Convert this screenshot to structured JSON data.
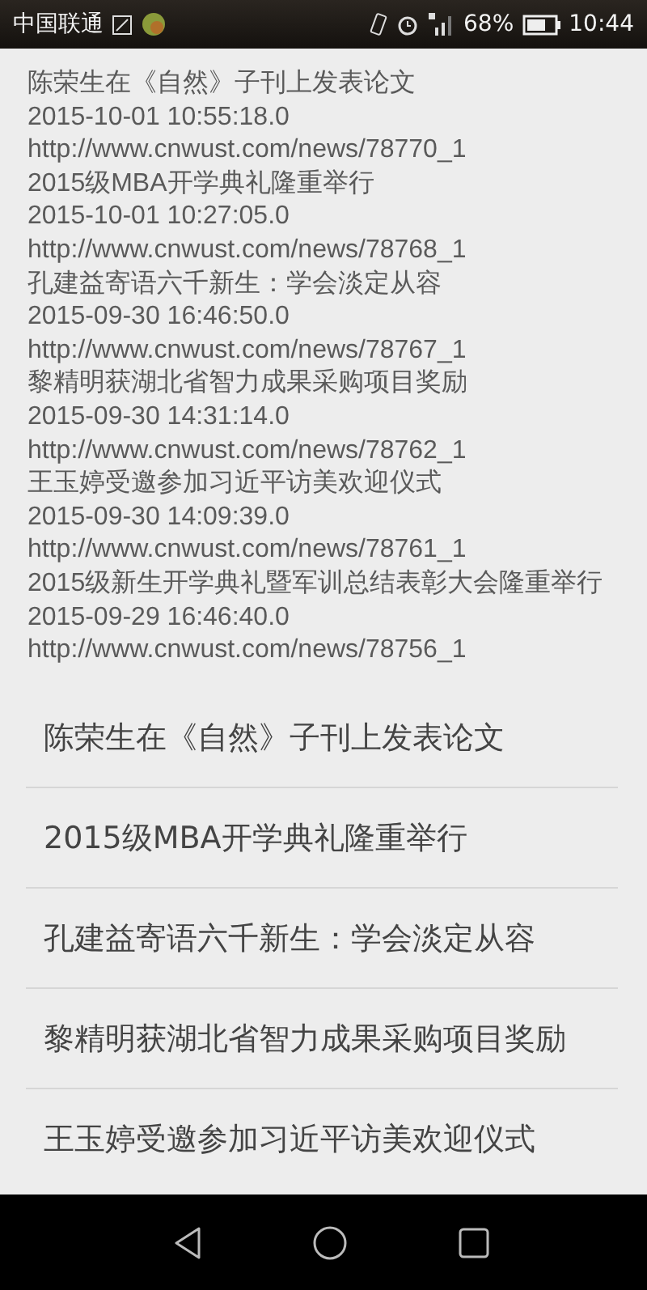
{
  "status_bar": {
    "carrier": "中国联通",
    "battery_text": "68%",
    "time": "10:44"
  },
  "log_lines": [
    "陈荣生在《自然》子刊上发表论文",
    "2015-10-01 10:55:18.0",
    "http://www.cnwust.com/news/78770_1",
    "2015级MBA开学典礼隆重举行",
    "2015-10-01 10:27:05.0",
    "http://www.cnwust.com/news/78768_1",
    "孔建益寄语六千新生：学会淡定从容",
    "2015-09-30 16:46:50.0",
    "http://www.cnwust.com/news/78767_1",
    "黎精明获湖北省智力成果采购项目奖励",
    "2015-09-30 14:31:14.0",
    "http://www.cnwust.com/news/78762_1",
    "王玉婷受邀参加习近平访美欢迎仪式",
    "2015-09-30 14:09:39.0",
    "http://www.cnwust.com/news/78761_1",
    "2015级新生开学典礼暨军训总结表彰大会隆重举行",
    "2015-09-29 16:46:40.0",
    "http://www.cnwust.com/news/78756_1"
  ],
  "news_list": [
    "陈荣生在《自然》子刊上发表论文",
    "2015级MBA开学典礼隆重举行",
    "孔建益寄语六千新生：学会淡定从容",
    "黎精明获湖北省智力成果采购项目奖励",
    "王玉婷受邀参加习近平访美欢迎仪式"
  ]
}
